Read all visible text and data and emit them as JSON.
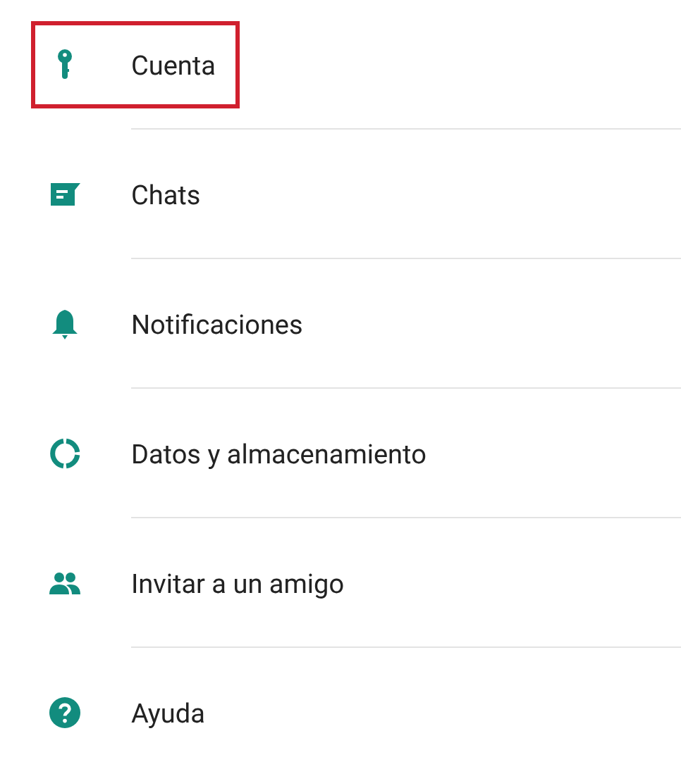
{
  "settings": [
    {
      "kind": "key",
      "label": "Cuenta",
      "highlighted": true
    },
    {
      "kind": "chat",
      "label": "Chats",
      "highlighted": false
    },
    {
      "kind": "bell",
      "label": "Notificaciones",
      "highlighted": false
    },
    {
      "kind": "data",
      "label": "Datos y almacenamiento",
      "highlighted": false
    },
    {
      "kind": "people",
      "label": "Invitar a un amigo",
      "highlighted": false
    },
    {
      "kind": "help",
      "label": "Ayuda",
      "highlighted": false
    }
  ]
}
